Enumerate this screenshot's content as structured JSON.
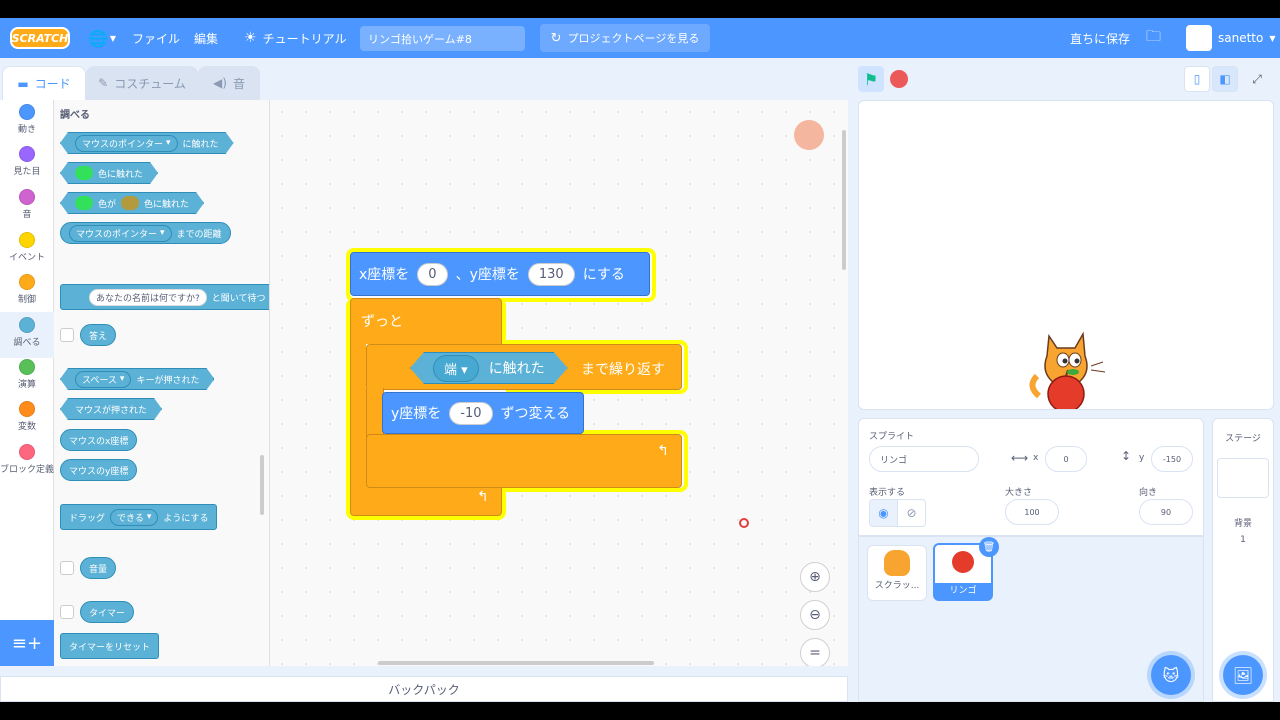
{
  "menubar": {
    "logo": "SCRATCH",
    "file": "ファイル",
    "edit": "編集",
    "tutorials": "チュートリアル",
    "project_title": "リンゴ拾いゲーム#8",
    "see_project_page": "プロジェクトページを見る",
    "save_now": "直ちに保存",
    "username": "sanetto"
  },
  "tabs": {
    "code": "コード",
    "costumes": "コスチューム",
    "sounds": "音"
  },
  "categories": [
    {
      "label": "動き",
      "color": "#4c97ff"
    },
    {
      "label": "見た目",
      "color": "#9966ff"
    },
    {
      "label": "音",
      "color": "#cf63cf"
    },
    {
      "label": "イベント",
      "color": "#ffd500"
    },
    {
      "label": "制御",
      "color": "#ffab19"
    },
    {
      "label": "調べる",
      "color": "#5cb1d6"
    },
    {
      "label": "演算",
      "color": "#59c059"
    },
    {
      "label": "変数",
      "color": "#ff8c1a"
    },
    {
      "label": "ブロック定義",
      "color": "#ff6680"
    }
  ],
  "palette": {
    "heading": "調べる",
    "touching_mouse": "マウスのポインター",
    "touching_suffix": "に触れた",
    "color_touching": "色に触れた",
    "color_is": "色が",
    "color_touching2": "色に触れた",
    "distance_target": "マウスのポインター",
    "distance_suffix": "までの距離",
    "ask_text": "あなたの名前は何ですか?",
    "ask_suffix": "と聞いて待つ",
    "answer": "答え",
    "key_name": "スペース",
    "key_suffix": "キーが押された",
    "mouse_down": "マウスが押された",
    "mouse_x": "マウスのx座標",
    "mouse_y": "マウスのy座標",
    "drag_prefix": "ドラッグ",
    "drag_mode": "できる",
    "drag_suffix": "ようにする",
    "loudness": "音量",
    "timer": "タイマー",
    "reset_timer": "タイマーをリセット"
  },
  "script": {
    "goto_x_label": "x座標を",
    "goto_x": "0",
    "goto_y_label": "、y座標を",
    "goto_y": "130",
    "goto_suffix": "にする",
    "forever": "ずっと",
    "touch_target": "端",
    "touch_label": "に触れた",
    "repeat_until": "まで繰り返す",
    "change_y_label": "y座標を",
    "change_y": "-10",
    "change_y_suffix": "ずつ変える"
  },
  "backpack": "バックパック",
  "sprite_info": {
    "sprite_label": "スプライト",
    "sprite_name": "リンゴ",
    "x_label": "x",
    "x_value": "0",
    "y_label": "y",
    "y_value": "-150",
    "show_label": "表示する",
    "size_label": "大きさ",
    "size_value": "100",
    "direction_label": "向き",
    "direction_value": "90"
  },
  "sprites": [
    {
      "name": "スクラッ..."
    },
    {
      "name": "リンゴ"
    }
  ],
  "stage_panel": {
    "title": "ステージ",
    "backdrops_label": "背景",
    "backdrops_count": "1"
  }
}
